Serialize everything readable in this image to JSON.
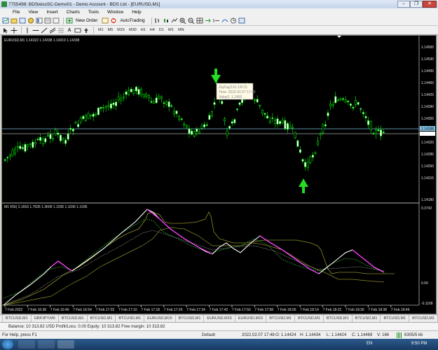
{
  "window": {
    "title": "7755498: BDSwissSC-Demo01 - Demo Account - BDS Ltd - [EURUSD,M1]",
    "minimize": "–",
    "maximize": "❐",
    "close": "✕"
  },
  "menu": [
    "File",
    "View",
    "Insert",
    "Charts",
    "Tools",
    "Window",
    "Help"
  ],
  "toolbar": {
    "new_order": "New Order",
    "autotrading": "AutoTrading",
    "timeframes": [
      "M1",
      "M5",
      "M15",
      "M30",
      "H1",
      "H4",
      "D1",
      "W1",
      "MN"
    ]
  },
  "chart": {
    "main_label": "EURUSD,M1  1.14322 1.14338 1.14319 1.14338",
    "rsi_label": "M1 RSI( 2.1653 1.7635 1.3609 1.1036 1.1036 1.1036",
    "price_ticks": [
      "1.14565",
      "1.14530",
      "1.14495",
      "1.14460",
      "1.14425",
      "1.14390",
      "1.14355",
      "1.14320",
      "1.14285",
      "1.14250",
      "1.14215",
      "1.14180"
    ],
    "current_price": "1.14338",
    "rsi_ticks": [
      "0.3742",
      "0.00",
      "-0.1168"
    ],
    "time_ticks": [
      "7 Feb 2022",
      "7 Feb 16:38",
      "7 Feb 16:46",
      "7 Feb 16:54",
      "7 Feb 17:02",
      "7 Feb 17:10",
      "7 Feb 17:18",
      "7 Feb 17:26",
      "7 Feb 17:34",
      "7 Feb 17:42",
      "7 Feb 17:50",
      "7 Feb 17:58",
      "7 Feb 18:06",
      "7 Feb 18:14",
      "7 Feb 18:22",
      "7 Feb 18:30",
      "7 Feb 18:38",
      "7 Feb 18:46"
    ],
    "tooltip": {
      "line1": "ZigZag(115,130,5)",
      "line2": "Time: 2022.02.07 17:48",
      "line3": "Value2: 1.1450"
    },
    "colors": {
      "bull": "#00ff00",
      "bear": "#00ff00",
      "arrow": "#22dd22",
      "rsi_white": "#ffffff",
      "rsi_magenta": "#ff33ff",
      "olive": "#8c8c2a",
      "green_dots": "#2faa2f",
      "hline": "#7fbfe0"
    }
  },
  "tabs": [
    "",
    "BTCUSD,M1",
    "GBPJPY,M5",
    "BTCUSD,M1",
    "BTCUSD,M1",
    "BTCUSD,M1",
    "EURUSD,M15",
    "BTCUSD,M1",
    "EURUSD,M15",
    "EURUSD,M15",
    "BTCUSD,M1",
    "BTCUSD,M1",
    "BTCUSD,M1",
    "BTCUSD,M1",
    "BTCUSD,M1",
    "BTCUSD,M1"
  ],
  "balance_bar": "Balance: 10 313.82 USD  Profit/Loss: 0.00  Equity: 10 313.82  Free margin: 10 313.82",
  "status": {
    "help": "For Help, press F1",
    "profile": "Default",
    "time": "2022.02.07 17:48",
    "open": "O: 1.14424",
    "high": "H: 1.14434",
    "low": "L: 1.14424",
    "close": "C: 1.14469",
    "volume": "V: 166",
    "traffic": "6305/5 kb"
  },
  "taskbar": {
    "lang": "EN",
    "clock": "9:50 PM"
  }
}
